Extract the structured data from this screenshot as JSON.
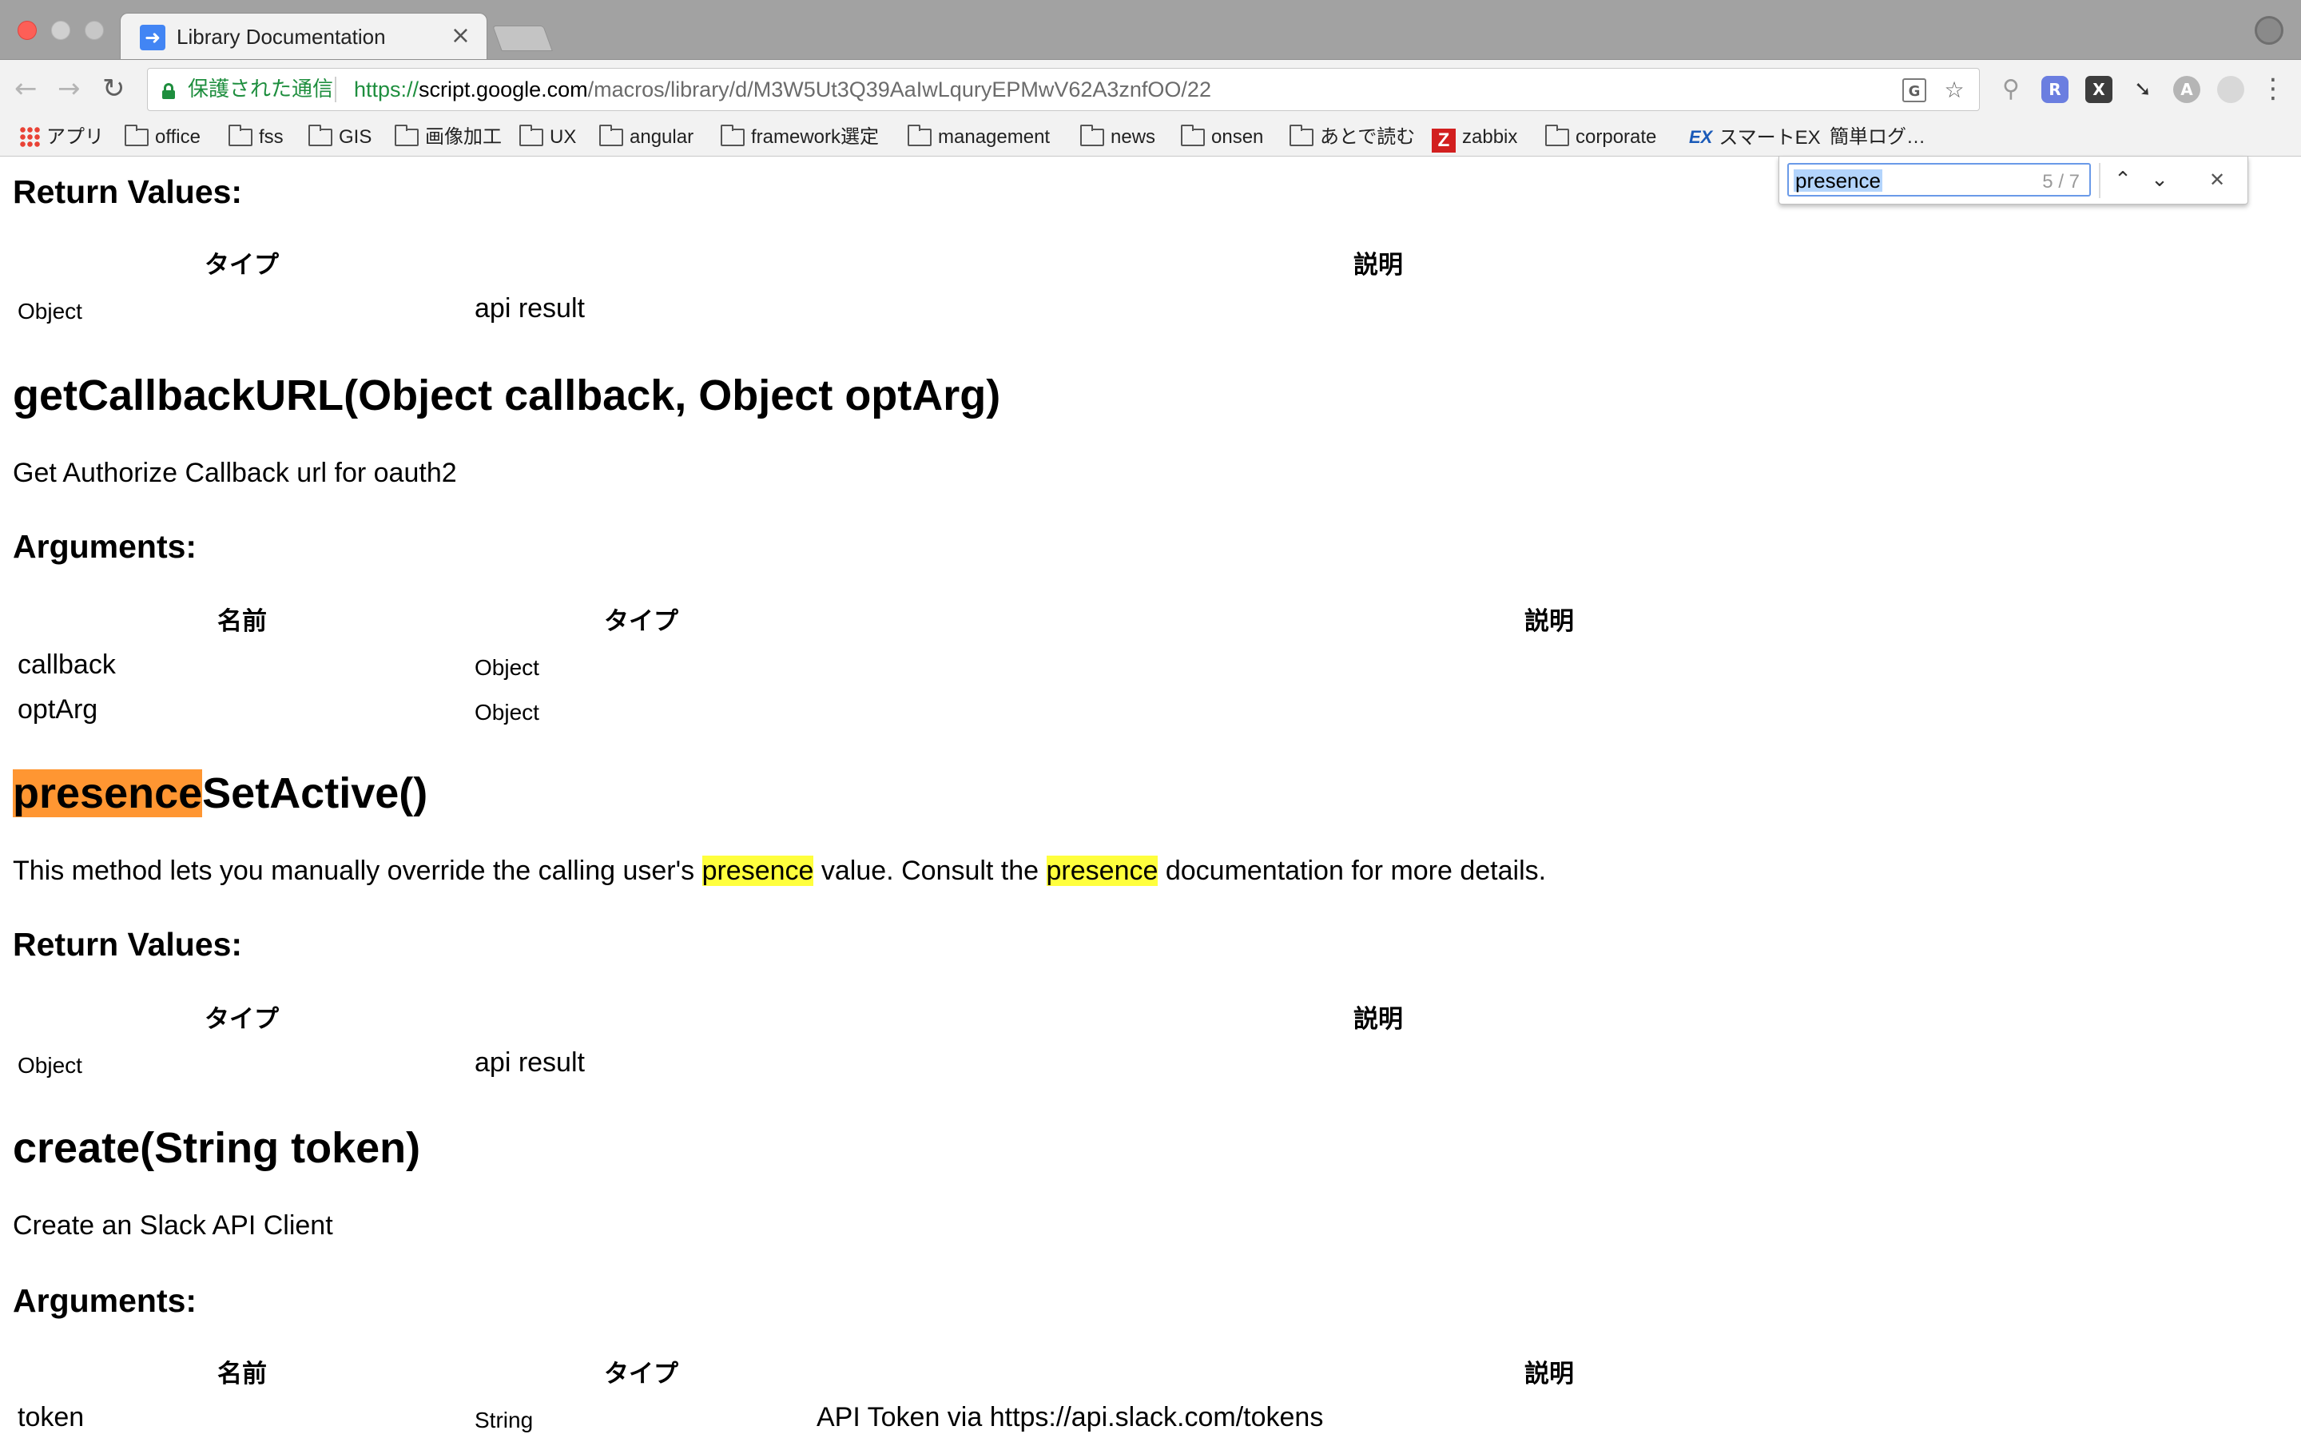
{
  "browser": {
    "tab_title": "Library Documentation",
    "secure_label": "保護された通信",
    "url_scheme": "https://",
    "url_host": "script.google.com",
    "url_path": "/macros/library/d/M3W5Ut3Q39AaIwLquryEPMwV62A3znfOO/22",
    "icons": {
      "back": "arrow-left-icon",
      "forward": "arrow-right-icon",
      "reload": "reload-icon",
      "lock": "lock-icon",
      "translate": "translate-icon",
      "bookmark": "star-icon",
      "menu": "kebab-menu-icon",
      "profile": "profile-icon"
    },
    "bookmarks": [
      {
        "label": "アプリ"
      },
      {
        "label": "office"
      },
      {
        "label": "fss"
      },
      {
        "label": "GIS"
      },
      {
        "label": "画像加工"
      },
      {
        "label": "UX"
      },
      {
        "label": "angular"
      },
      {
        "label": "framework選定"
      },
      {
        "label": "management"
      },
      {
        "label": "news"
      },
      {
        "label": "onsen"
      },
      {
        "label": "あとで読む"
      },
      {
        "label": "zabbix"
      },
      {
        "label": "corporate"
      },
      {
        "label": "スマートEX"
      },
      {
        "label": "簡単ログ…"
      }
    ],
    "extensions": {
      "ext2": "R",
      "ext3": "X",
      "ext5": "A"
    }
  },
  "find": {
    "query": "presence",
    "count": "5 / 7"
  },
  "colors": {
    "find_highlight": "#ffff3d",
    "find_active_highlight": "#ff9632",
    "secure_green": "#1e8e3e"
  },
  "doc": {
    "section1": {
      "return_heading": "Return Values:",
      "col_type": "タイプ",
      "col_desc": "説明",
      "row_type": "Object",
      "row_desc": "api result"
    },
    "section2": {
      "title": "getCallbackURL(Object callback, Object optArg)",
      "description": "Get Authorize Callback url for oauth2",
      "args_heading": "Arguments:",
      "col_name": "名前",
      "col_type": "タイプ",
      "col_desc": "説明",
      "rows": [
        {
          "name": "callback",
          "type": "Object"
        },
        {
          "name": "optArg",
          "type": "Object"
        }
      ]
    },
    "section3": {
      "title_match": "presence",
      "title_rest": "SetActive()",
      "desc_part1": "This method lets you manually override the calling user's ",
      "desc_match1": "presence",
      "desc_part2": " value. Consult the ",
      "desc_match2": "presence",
      "desc_part3": " documentation for more details.",
      "return_heading": "Return Values:",
      "col_type": "タイプ",
      "col_desc": "説明",
      "row_type": "Object",
      "row_desc": "api result"
    },
    "section4": {
      "title": "create(String token)",
      "description": "Create an Slack API Client",
      "args_heading": "Arguments:",
      "col_name": "名前",
      "col_type": "タイプ",
      "col_desc": "説明",
      "rows": [
        {
          "name": "token",
          "type": "String",
          "desc": "API Token via https://api.slack.com/tokens"
        }
      ]
    }
  }
}
